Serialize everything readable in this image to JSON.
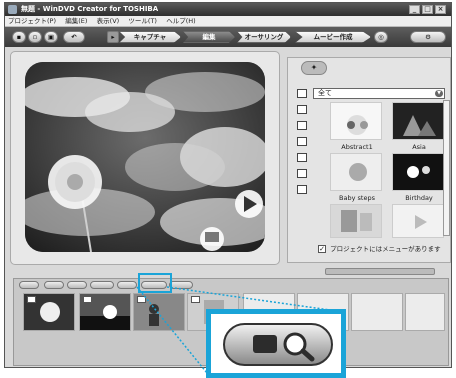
{
  "window": {
    "title": "無題 - WinDVD Creator for TOSHIBA",
    "controls": [
      "_",
      "□",
      "×"
    ]
  },
  "menu": {
    "items": [
      "プロジェクト(P)",
      "編集(E)",
      "表示(V)",
      "ツール(T)",
      "ヘルプ(H)"
    ]
  },
  "toolbar": {
    "modes": [
      "キャプチャ",
      "編集",
      "オーサリング",
      "ムービー作成"
    ],
    "active_mode": "編集"
  },
  "library": {
    "filter": "全て",
    "items": [
      {
        "label": "Abstract1"
      },
      {
        "label": "Asia"
      },
      {
        "label": "Baby steps"
      },
      {
        "label": "Birthday"
      },
      {
        "label": ""
      },
      {
        "label": ""
      }
    ]
  },
  "options": {
    "menu_checkbox_label": "プロジェクトにはメニューがあります",
    "menu_checkbox_checked": true
  },
  "storyboard": {
    "clips": [
      {
        "name": "clip-dandelion"
      },
      {
        "name": "clip-sunset"
      },
      {
        "name": "clip-people"
      },
      {
        "name": "clip-window"
      }
    ]
  },
  "colors": {
    "highlight": "#1aa4d8",
    "toolbar_dark": "#3a3a3a"
  }
}
